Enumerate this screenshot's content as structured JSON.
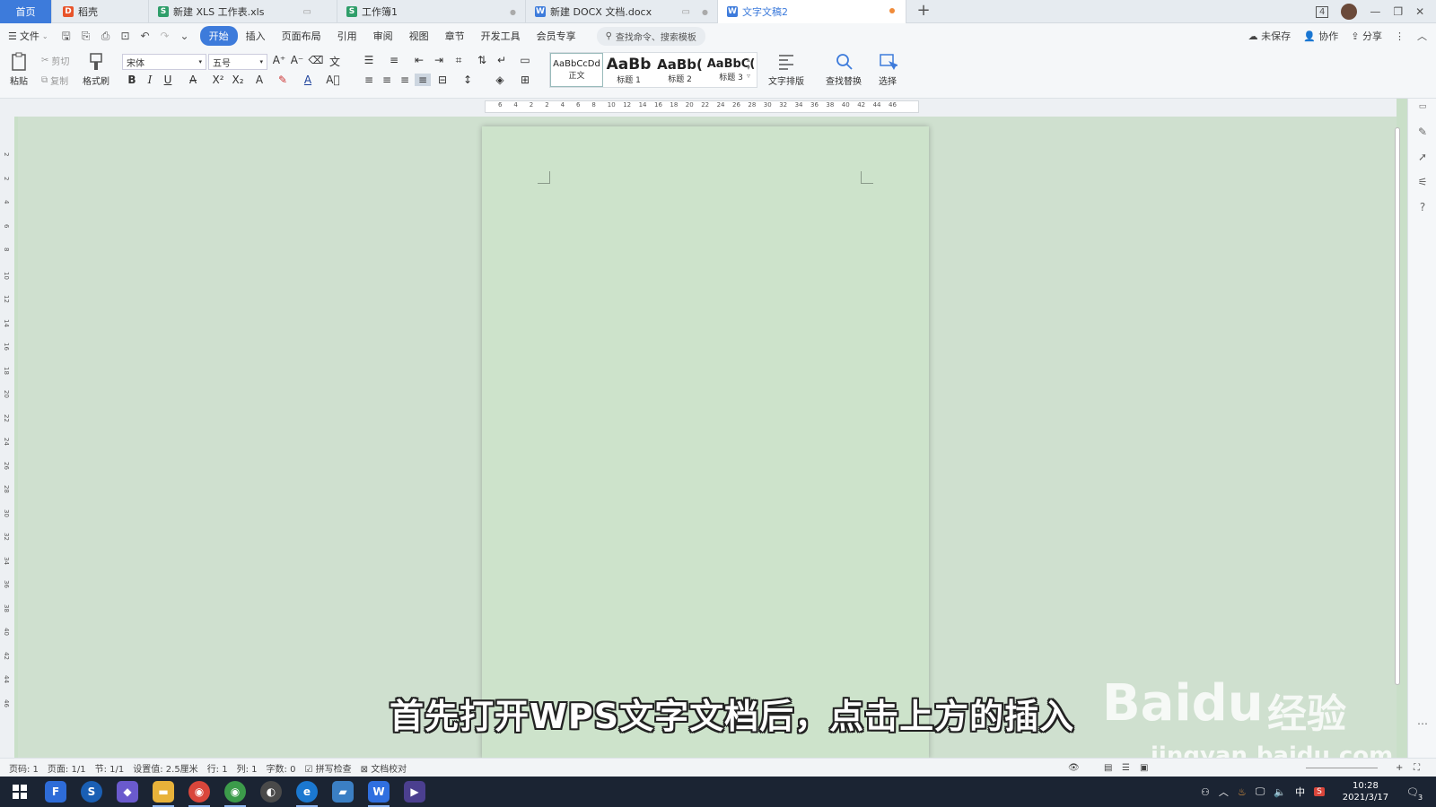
{
  "tabs": [
    {
      "label": "首页",
      "type": "home"
    },
    {
      "label": "稻壳",
      "icon": "docer-icon",
      "color": "#e8542b"
    },
    {
      "label": "新建 XLS 工作表.xls",
      "icon": "spreadsheet-icon",
      "color": "#2f9e6a"
    },
    {
      "label": "工作簿1",
      "icon": "spreadsheet-icon",
      "color": "#2f9e6a"
    },
    {
      "label": "新建 DOCX 文档.docx",
      "icon": "writer-icon",
      "color": "#3d7bdb"
    },
    {
      "label": "文字文稿2",
      "icon": "writer-icon",
      "color": "#3d7bdb",
      "active": true
    }
  ],
  "window": {
    "badge": "4"
  },
  "menu": {
    "file": "文件",
    "items": [
      "开始",
      "插入",
      "页面布局",
      "引用",
      "审阅",
      "视图",
      "章节",
      "开发工具",
      "会员专享"
    ],
    "active_index": 0,
    "search_placeholder": "查找命令、搜索模板",
    "right": [
      "未保存",
      "协作",
      "分享"
    ]
  },
  "ribbon": {
    "paste": "粘贴",
    "cut": "剪切",
    "copy": "复制",
    "format_painter": "格式刷",
    "font_name": "宋体",
    "font_size": "五号",
    "styles": [
      {
        "preview": "AaBbCcDd",
        "label": "正文"
      },
      {
        "preview": "AaBb",
        "label": "标题 1"
      },
      {
        "preview": "AaBb(",
        "label": "标题 2"
      },
      {
        "preview": "AaBbC(",
        "label": "标题 3"
      }
    ],
    "text_layout": "文字排版",
    "find_replace": "查找替换",
    "select": "选择"
  },
  "ruler": {
    "h_numbers": [
      "6",
      "4",
      "2",
      "2",
      "4",
      "6",
      "8",
      "10",
      "12",
      "14",
      "16",
      "18",
      "20",
      "22",
      "24",
      "26",
      "28",
      "30",
      "32",
      "34",
      "36",
      "38",
      "40",
      "42",
      "44",
      "46"
    ],
    "v_numbers": [
      "2",
      "2",
      "4",
      "6",
      "8",
      "10",
      "12",
      "14",
      "16",
      "18",
      "20",
      "22",
      "24",
      "26",
      "28",
      "30",
      "32",
      "34",
      "36",
      "38",
      "40",
      "42",
      "44",
      "46"
    ]
  },
  "subtitle": "首先打开WPS文字文档后，点击上方的插入",
  "watermark": {
    "brand": "Baidu",
    "cn": "经验",
    "url": "jingyan.baidu.com"
  },
  "status": {
    "page_no": "页码: 1",
    "pages": "页面: 1/1",
    "section": "节: 1/1",
    "setting": "设置值: 2.5厘米",
    "row": "行: 1",
    "col": "列: 1",
    "words": "字数: 0",
    "spell": "拼写检查",
    "proof": "文档校对"
  },
  "taskbar": {
    "apps": [
      "feishu-icon",
      "sogou-icon",
      "cube-icon",
      "explorer-icon",
      "chrome-icon",
      "chrome-icon",
      "app-icon",
      "edge-icon",
      "notes-icon",
      "wps-icon",
      "media-icon"
    ],
    "ime": "中",
    "time": "10:28",
    "date": "2021/3/17",
    "notify": "3"
  }
}
